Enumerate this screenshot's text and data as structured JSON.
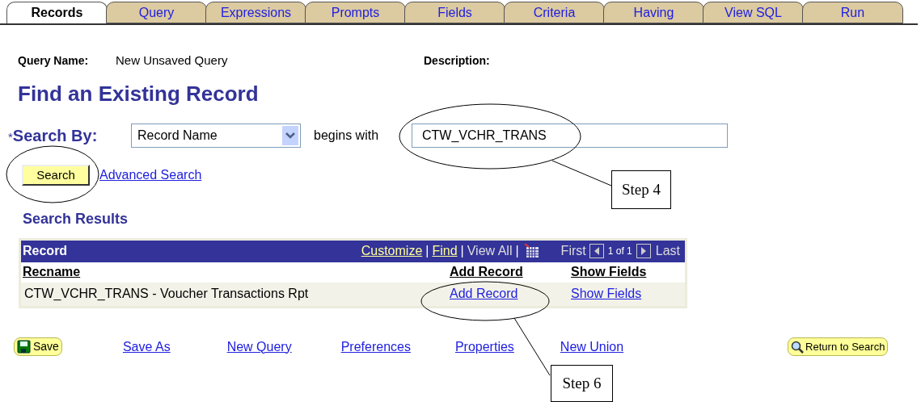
{
  "tabs": [
    {
      "label": "Records",
      "selected": true
    },
    {
      "label": "Query",
      "selected": false
    },
    {
      "label": "Expressions",
      "selected": false
    },
    {
      "label": "Prompts",
      "selected": false
    },
    {
      "label": "Fields",
      "selected": false
    },
    {
      "label": "Criteria",
      "selected": false
    },
    {
      "label": "Having",
      "selected": false
    },
    {
      "label": "View SQL",
      "selected": false
    },
    {
      "label": "Run",
      "selected": false
    }
  ],
  "query_name": {
    "label": "Query Name:",
    "value": "New Unsaved Query"
  },
  "description": {
    "label": "Description:"
  },
  "heading": "Find an Existing Record",
  "search_by": {
    "required_mark": "*",
    "label": "Search By:",
    "select_value": "Record Name",
    "operator": "begins with",
    "value": "CTW_VCHR_TRANS"
  },
  "search_button": "Search",
  "advanced_search": "Advanced Search",
  "results": {
    "title": "Search Results",
    "grid_title": "Record",
    "nav": {
      "customize": "Customize",
      "find": "Find",
      "view_all": "View All",
      "first": "First",
      "count": "1 of 1",
      "last": "Last",
      "separator": "|"
    },
    "columns": [
      "Recname",
      "Add Record",
      "Show Fields"
    ],
    "rows": [
      [
        "CTW_VCHR_TRANS - Voucher Transactions Rpt",
        "Add Record",
        "Show Fields"
      ]
    ]
  },
  "footer": {
    "save": "Save",
    "links": [
      "Save As",
      "New Query",
      "Preferences",
      "Properties",
      "New Union"
    ],
    "return": "Return to Search"
  },
  "callouts": [
    {
      "text": "Step 4"
    },
    {
      "text": "Step 6"
    }
  ]
}
